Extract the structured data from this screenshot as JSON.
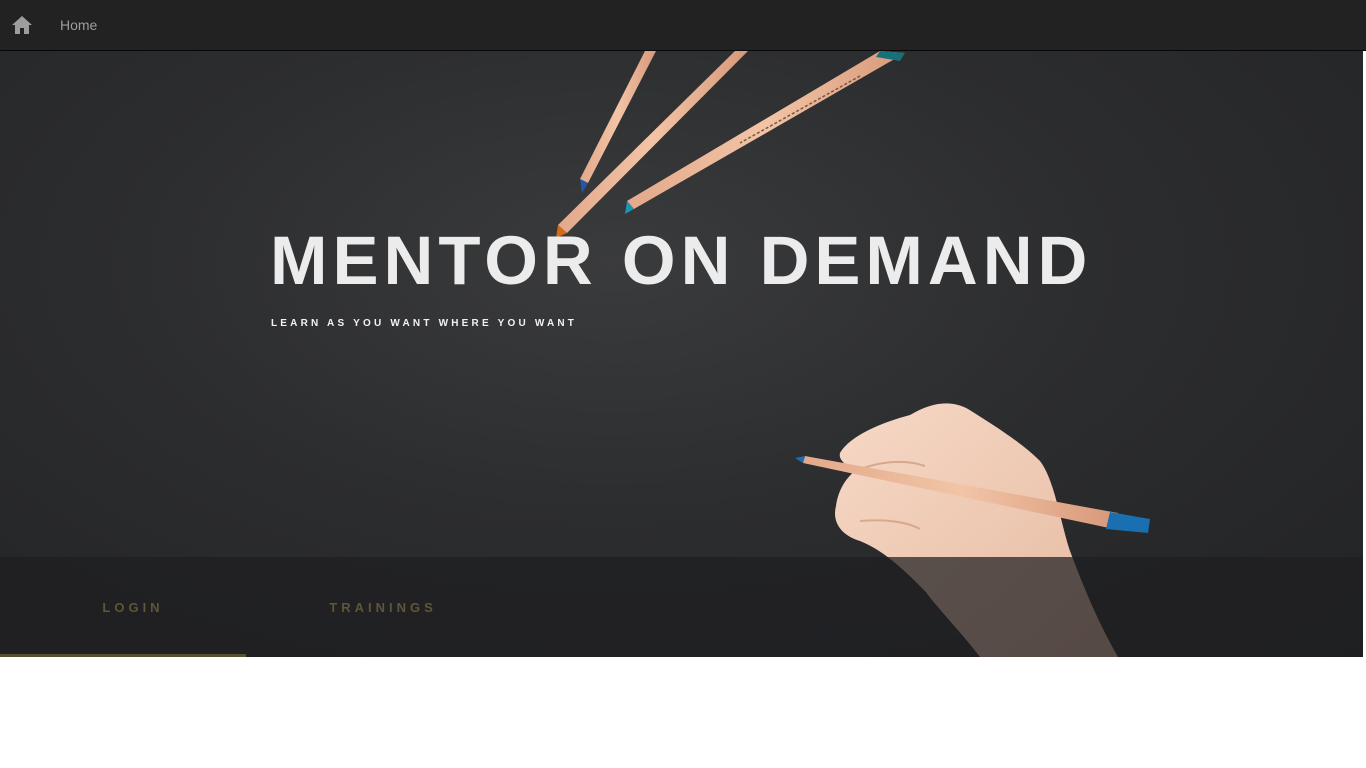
{
  "navbar": {
    "home_icon": "home-icon",
    "home_label": "Home"
  },
  "hero": {
    "title": "MENTOR ON DEMAND",
    "subtitle": "LEARN AS YOU WANT WHERE YOU WANT"
  },
  "tabs": [
    {
      "label": "LOGIN",
      "active": true
    },
    {
      "label": "TRAININGS",
      "active": false
    }
  ],
  "colors": {
    "navbar_bg": "#222222",
    "nav_text": "#9d9d9d",
    "hero_bg": "#2c2d2f",
    "title_text": "#ececec",
    "tab_text": "#5e5638",
    "tab_indicator": "#5a5030"
  }
}
